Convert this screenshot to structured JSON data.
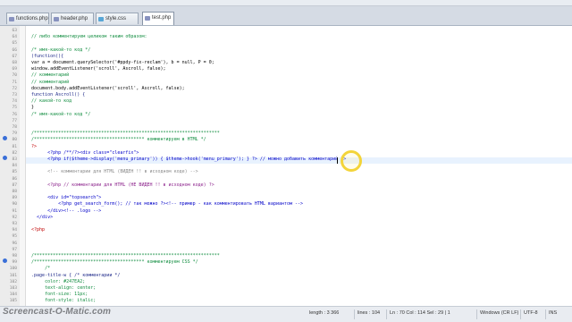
{
  "tabs": [
    {
      "label": "functions.php",
      "color": "#8892bf"
    },
    {
      "label": "header.php",
      "color": "#8892bf"
    },
    {
      "label": "style.css",
      "color": "#58a6d6"
    },
    {
      "label": "test.php",
      "color": "#8892bf",
      "active": true
    }
  ],
  "code_lines": [
    {
      "n": "63",
      "t": "",
      "c": ""
    },
    {
      "n": "64",
      "t": "  // либо комментируем целиком таким образом:",
      "c": "green"
    },
    {
      "n": "65",
      "t": "",
      "c": ""
    },
    {
      "n": "66",
      "t": "  /* имя-какой-то код */",
      "c": "green"
    },
    {
      "n": "67",
      "t": "  (function(){",
      "c": "navy"
    },
    {
      "n": "68",
      "t": "  var a = document.querySelector('#ppdy-fix-reclam'), b = null, P = 0;",
      "c": ""
    },
    {
      "n": "69",
      "t": "  window.addEventListener('scroll', Ascroll, false);",
      "c": ""
    },
    {
      "n": "70",
      "t": "  // комментарий",
      "c": "green"
    },
    {
      "n": "71",
      "t": "  // комментарий",
      "c": "green"
    },
    {
      "n": "72",
      "t": "  document.body.addEventListener('scroll', Ascroll, false);",
      "c": ""
    },
    {
      "n": "73",
      "t": "  function Ascroll() {",
      "c": "navy"
    },
    {
      "n": "74",
      "t": "  // какой-то код",
      "c": "green"
    },
    {
      "n": "75",
      "t": "  }",
      "c": ""
    },
    {
      "n": "76",
      "t": "  /* имя-какой-то код */",
      "c": "green"
    },
    {
      "n": "77",
      "t": "",
      "c": ""
    },
    {
      "n": "78",
      "t": "",
      "c": ""
    },
    {
      "n": "79",
      "t": "  /*********************************************************************",
      "c": "green"
    },
    {
      "n": "80",
      "t": "  /***************************************** комментируем в HTML */",
      "c": "green"
    },
    {
      "n": "81",
      "t": "  ?>",
      "c": "red"
    },
    {
      "n": "82",
      "t": "        <?php /**/?><div class=\"clearfix\">",
      "c": "blue"
    },
    {
      "n": "83",
      "t": "        <?php if($theme->display('menu_primary')) { $theme->hook('menu_primary'); } ?> // можно добавить комментарий ?>",
      "c": "blue",
      "highlight": true
    },
    {
      "n": "84",
      "t": "",
      "c": ""
    },
    {
      "n": "85",
      "t": "        <!-- комментарии для HTML (ВИДЕН !! в исходном коде) -->",
      "c": "gray"
    },
    {
      "n": "86",
      "t": "",
      "c": ""
    },
    {
      "n": "87",
      "t": "        <?php // комментарии для HTML (НЕ ВИДЕН !! в исходном коде) ?>",
      "c": "purple"
    },
    {
      "n": "88",
      "t": "",
      "c": ""
    },
    {
      "n": "89",
      "t": "        <div id=\"topsearch\">",
      "c": "blue"
    },
    {
      "n": "90",
      "t": "            <?php get_search_form(); // так можно ?><!-- пример - как комментировать HTML вариантом -->",
      "c": "blue"
    },
    {
      "n": "91",
      "t": "        </div><!-- .logo -->",
      "c": "blue"
    },
    {
      "n": "92",
      "t": "    </div>",
      "c": "blue"
    },
    {
      "n": "93",
      "t": "",
      "c": ""
    },
    {
      "n": "94",
      "t": "  <?php",
      "c": "red"
    },
    {
      "n": "95",
      "t": "",
      "c": ""
    },
    {
      "n": "96",
      "t": "",
      "c": ""
    },
    {
      "n": "97",
      "t": "",
      "c": ""
    },
    {
      "n": "98",
      "t": "  /*********************************************************************",
      "c": "green"
    },
    {
      "n": "99",
      "t": "  /***************************************** комментируем CSS */",
      "c": "green"
    },
    {
      "n": "100",
      "t": "       /*",
      "c": "green"
    },
    {
      "n": "101",
      "t": "  .page-title-w { /* комментарии */",
      "c": "navy"
    },
    {
      "n": "102",
      "t": "       color: #247EA2;",
      "c": "green"
    },
    {
      "n": "103",
      "t": "       text-align: center;",
      "c": "green"
    },
    {
      "n": "104",
      "t": "       font-size: 11px;",
      "c": "green"
    },
    {
      "n": "105",
      "t": "       font-style: italic;",
      "c": "green"
    }
  ],
  "status": {
    "length": "length : 3 366",
    "lines": "lines : 104",
    "ln_col": "Ln : 70   Col : 114   Sel : 29 | 1",
    "eol": "Windows (CR LF)",
    "encoding": "UTF-8",
    "mode": "INS"
  },
  "watermark": "Screencast-O-Matic.com"
}
